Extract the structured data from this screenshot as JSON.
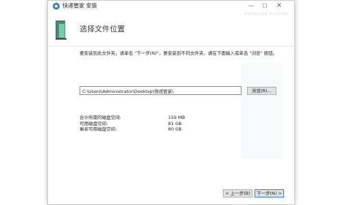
{
  "window": {
    "title": "快递管家 安装"
  },
  "header": {
    "title": "选择文件位置",
    "brand": "Advanced Installer"
  },
  "content": {
    "instruction": "要安装到此文件夹，请单击 \"下一步(N)\"，要安装到不同文件夹，请在下面输入或单击 \"浏览\" 按钮。",
    "path_value": "C:\\Users\\Administrator\\Desktop\\快递管家\\",
    "browse_label": "浏览(R)...",
    "space": [
      {
        "label": "合计所需的磁盘空间:",
        "value": "159 MB"
      },
      {
        "label": "可用磁盘空间:",
        "value": "81 GB"
      },
      {
        "label": "剩余可用磁盘空间:",
        "value": "80 GB"
      }
    ]
  },
  "footer": {
    "back_label": "< 上一步(B)",
    "next_label": "下一步(N) >"
  }
}
